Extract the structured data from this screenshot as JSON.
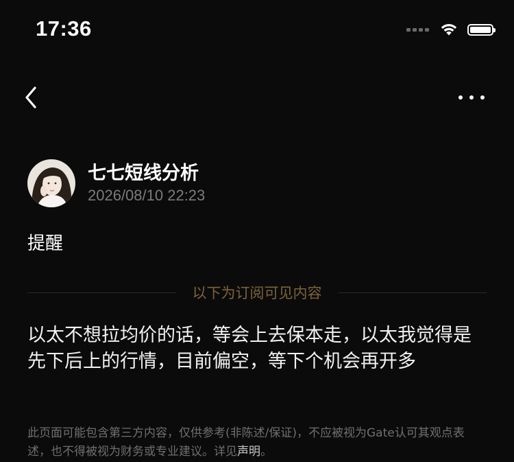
{
  "status_bar": {
    "time": "17:36",
    "icons": [
      "signal-dots-icon",
      "wifi-icon",
      "battery-icon"
    ],
    "battery_level": 1.0
  },
  "nav": {
    "back_icon": "chevron-left-icon",
    "more_icon": "more-dots-icon"
  },
  "author": {
    "name": "七七短线分析",
    "timestamp": "2026/08/10 22:23",
    "avatar_icon": "avatar"
  },
  "post": {
    "title": "提醒",
    "subscriber_divider": "以下为订阅可见内容",
    "body": "以太不想拉均价的话，等会上去保本走，以太我觉得是先下后上的行情，目前偏空，等下个机会再开多"
  },
  "disclaimer": {
    "text": "此页面可能包含第三方内容，仅供参考(非陈述/保证)，不应被视为Gate认可其观点表述，也不得被视为财务或专业建议。详见",
    "link_label": "声明",
    "suffix": "。"
  },
  "colors": {
    "background": "#0b0b0b",
    "divider_text": "#7d6338",
    "muted_text": "#7c7c7c"
  }
}
